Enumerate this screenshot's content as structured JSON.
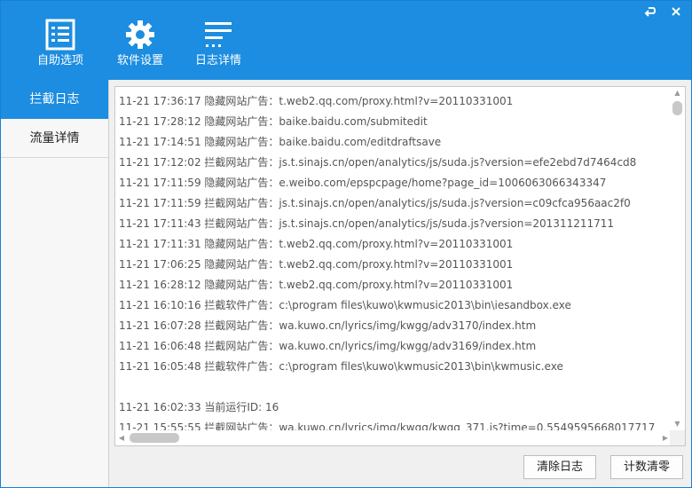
{
  "window_controls": {
    "minimize_icon": "restore-arrow-icon",
    "close_icon": "close-icon"
  },
  "toolbar": {
    "self_options": {
      "label": "自助选项",
      "icon": "checklist-icon"
    },
    "software_settings": {
      "label": "软件设置",
      "icon": "gear-icon"
    },
    "log_details": {
      "label": "日志详情",
      "icon": "menu-list-icon"
    }
  },
  "sidebar": {
    "items": [
      {
        "label": "拦截日志",
        "active": true
      },
      {
        "label": "流量详情",
        "active": false
      }
    ]
  },
  "log": {
    "lines": [
      "11-21 17:36:17 隐藏网站广告：t.web2.qq.com/proxy.html?v=20110331001",
      "11-21 17:28:12 隐藏网站广告：baike.baidu.com/submitedit",
      "11-21 17:14:51 隐藏网站广告：baike.baidu.com/editdraftsave",
      "11-21 17:12:02 拦截网站广告：js.t.sinajs.cn/open/analytics/js/suda.js?version=efe2ebd7d7464cd8",
      "11-21 17:11:59 隐藏网站广告：e.weibo.com/epspcpage/home?page_id=1006063066343347",
      "11-21 17:11:59 拦截网站广告：js.t.sinajs.cn/open/analytics/js/suda.js?version=c09cfca956aac2f0",
      "11-21 17:11:43 拦截网站广告：js.t.sinajs.cn/open/analytics/js/suda.js?version=201311211711",
      "11-21 17:11:31 隐藏网站广告：t.web2.qq.com/proxy.html?v=20110331001",
      "11-21 17:06:25 隐藏网站广告：t.web2.qq.com/proxy.html?v=20110331001",
      "11-21 16:28:12 隐藏网站广告：t.web2.qq.com/proxy.html?v=20110331001",
      "11-21 16:10:16 拦截软件广告：c:\\program files\\kuwo\\kwmusic2013\\bin\\iesandbox.exe",
      "11-21 16:07:28 拦截网站广告：wa.kuwo.cn/lyrics/img/kwgg/adv3170/index.htm",
      "11-21 16:06:48 拦截网站广告：wa.kuwo.cn/lyrics/img/kwgg/adv3169/index.htm",
      "11-21 16:05:48 拦截软件广告：c:\\program files\\kuwo\\kwmusic2013\\bin\\kwmusic.exe",
      "",
      "11-21 16:02:33 当前运行ID: 16",
      "11-21 15:55:55 拦截网站广告：wa.kuwo.cn/lyrics/img/kwgg/kwgg_371.js?time=0.5549595668017717"
    ]
  },
  "buttons": {
    "clear_log": "清除日志",
    "reset_count": "计数清零"
  },
  "colors": {
    "accent": "#1c8de0"
  }
}
